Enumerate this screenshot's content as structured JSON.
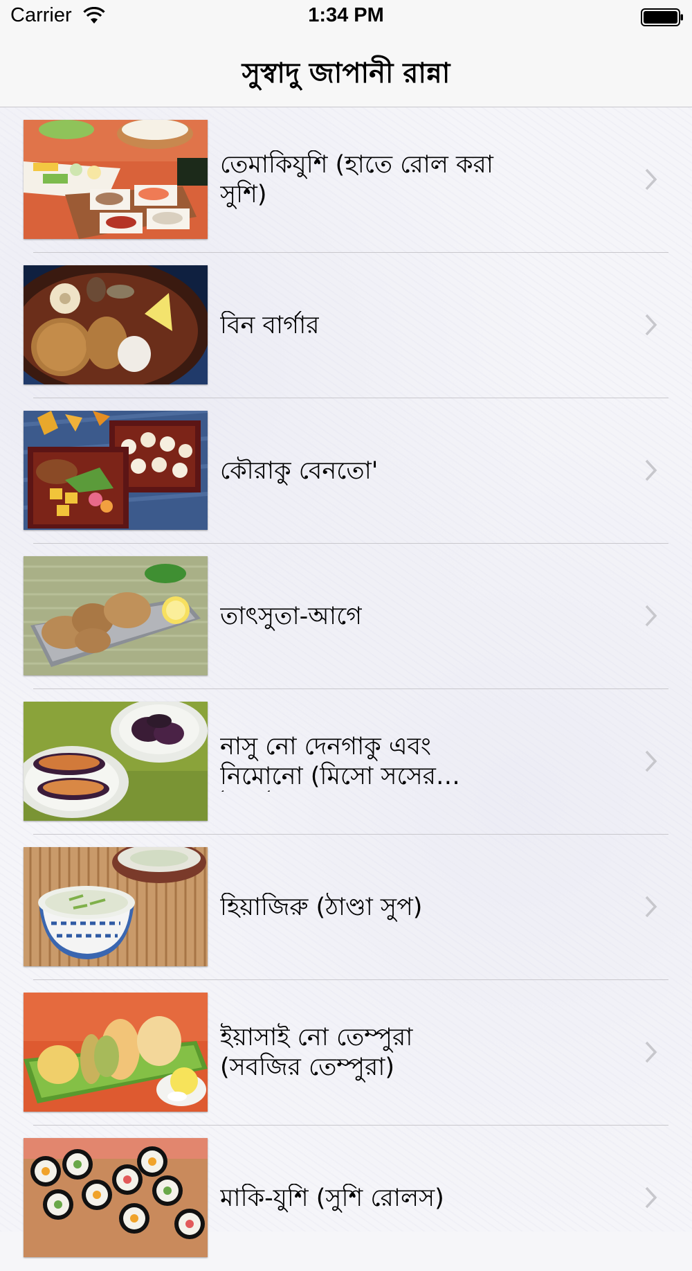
{
  "status_bar": {
    "carrier": "Carrier",
    "time": "1:34 PM",
    "wifi_icon": "wifi-icon",
    "battery_icon": "battery-icon"
  },
  "nav": {
    "title": "সুস্বাদু জাপানী রান্না"
  },
  "recipes": [
    {
      "title": "তেমাকিযুশি (হাতে রোল করা সুশি)",
      "image": "temaki-sushi-spread",
      "chevron": "chevron-right-icon"
    },
    {
      "title": "বিন বার্গার",
      "image": "bean-burger-plate",
      "chevron": "chevron-right-icon"
    },
    {
      "title": "কৌরাকু বেনতো'",
      "image": "bento-boxes",
      "chevron": "chevron-right-icon"
    },
    {
      "title": "তাৎসুতা-আগে",
      "image": "fried-chicken-plate",
      "chevron": "chevron-right-icon"
    },
    {
      "title": "নাসু নো দেনগাকু এবং নিমোনো (মিসো সসের টমেটো সহ বেগুন)",
      "image": "eggplant-dishes",
      "chevron": "chevron-right-icon"
    },
    {
      "title": "হিয়াজিরু (ঠাণ্ডা সুপ)",
      "image": "cold-soup-bowls",
      "chevron": "chevron-right-icon"
    },
    {
      "title": "ইয়াসাই নো তেম্পুরা (সবজির তেম্পুরা)",
      "image": "vegetable-tempura",
      "chevron": "chevron-right-icon"
    },
    {
      "title": "মাকি-যুশি (সুশি রোলস)",
      "image": "maki-sushi-rolls",
      "chevron": "chevron-right-icon"
    }
  ]
}
